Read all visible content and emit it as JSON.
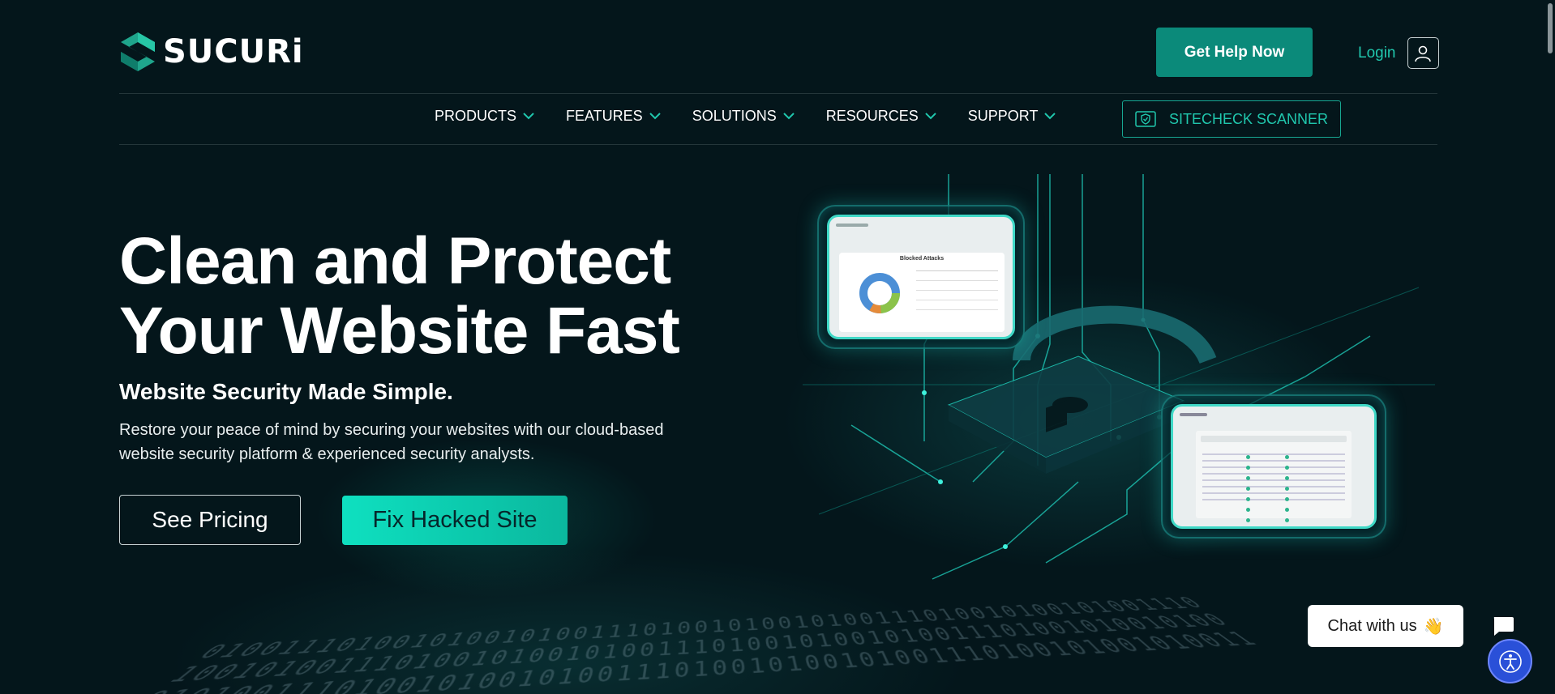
{
  "brand": {
    "name": "SUCURi",
    "accent": "#20c7ad",
    "button_teal": "#0b8a7a",
    "background": "#04161b"
  },
  "header": {
    "cta_label": "Get Help Now",
    "login_label": "Login",
    "login_icon": "user-icon"
  },
  "nav": {
    "items": [
      {
        "label": "PRODUCTS"
      },
      {
        "label": "FEATURES"
      },
      {
        "label": "SOLUTIONS"
      },
      {
        "label": "RESOURCES"
      },
      {
        "label": "SUPPORT"
      }
    ],
    "sitecheck_label": "SITECHECK SCANNER",
    "sitecheck_icon": "shield-check-icon"
  },
  "hero": {
    "title_line1": "Clean and Protect",
    "title_line2": "Your Website Fast",
    "subtitle": "Website Security Made Simple.",
    "description": "Restore your peace of mind by securing your websites with our cloud-based website security platform & experienced security analysts.",
    "pricing_label": "See Pricing",
    "fix_label": "Fix Hacked Site"
  },
  "illustration": {
    "top_screen_title": "Blocked Attacks"
  },
  "chat": {
    "label": "Chat with us",
    "emoji": "👋"
  }
}
